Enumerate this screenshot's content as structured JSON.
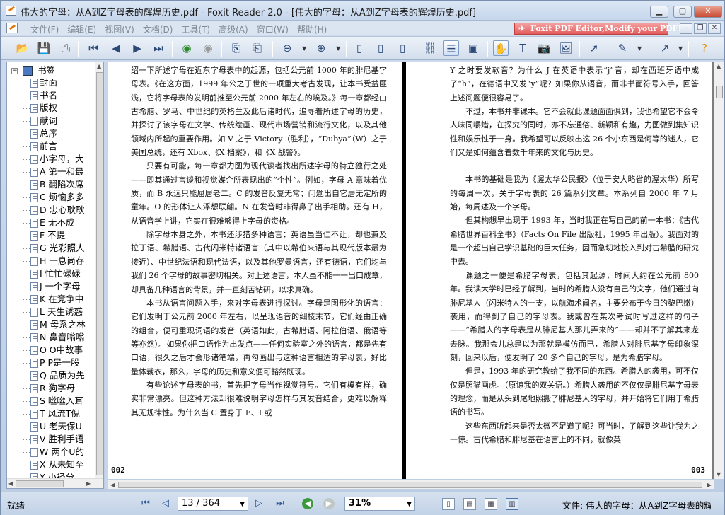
{
  "window": {
    "title": "伟大的字母：从A到Z字母表的辉煌历史.pdf - Foxit Reader 2.0 - [伟大的字母：从A到Z字母表的辉煌历史.pdf]",
    "min_label": "▁",
    "max_label": "▢",
    "close_label": "✕"
  },
  "menu": {
    "items": [
      "文件(F)",
      "编辑(E)",
      "视图(V)",
      "文档(D)",
      "工具(T)",
      "高级(A)",
      "窗口(W)",
      "帮助(H)"
    ],
    "ad_text": "Foxit PDF Editor,Modify your PDF!"
  },
  "toolbar": {
    "icons": [
      "open-icon",
      "save-icon",
      "print-icon",
      "first-page-icon",
      "prev-page-icon",
      "next-page-icon",
      "last-page-icon",
      "go-back-icon",
      "go-forward-icon",
      "rotate-left-icon",
      "rotate-right-icon",
      "zoom-out-icon",
      "zoom-in-icon",
      "single-page-icon",
      "continuous-icon",
      "facing-icon",
      "binoculars-icon",
      "bookmark-panel-icon",
      "thumbnail-icon",
      "hand-tool-icon",
      "text-select-icon",
      "snapshot-icon",
      "image-tool-icon",
      "select-arrow-icon",
      "annotation-icon",
      "pen-tool-icon",
      "help-icon"
    ]
  },
  "sidebar": {
    "root_label": "书签",
    "items": [
      {
        "label": "封面"
      },
      {
        "label": "书名"
      },
      {
        "label": "版权"
      },
      {
        "label": "献词"
      },
      {
        "label": "总序"
      },
      {
        "label": "前言"
      },
      {
        "label": "小字母，大"
      },
      {
        "label": "A 第一和最"
      },
      {
        "label": "B 翻陷次席"
      },
      {
        "label": "C 烦恼多多"
      },
      {
        "label": "D 忠心耿耿"
      },
      {
        "label": "E 无不成"
      },
      {
        "label": "F 不提"
      },
      {
        "label": "G 光彩照人"
      },
      {
        "label": "H 一息尚存"
      },
      {
        "label": "I 忙忙碌碌"
      },
      {
        "label": "J 一个字母"
      },
      {
        "label": "K 在竞争中"
      },
      {
        "label": "L 天生诱惑"
      },
      {
        "label": "M 母系之林"
      },
      {
        "label": "N 鼻音嗡嗡"
      },
      {
        "label": "O O中故事"
      },
      {
        "label": "P P是一股"
      },
      {
        "label": "Q 品质为先"
      },
      {
        "label": "R 狗字母"
      },
      {
        "label": "S 咝咝入耳"
      },
      {
        "label": "T 风流T倪"
      },
      {
        "label": "U 老天保U"
      },
      {
        "label": "V 胜利手语"
      },
      {
        "label": "W 两个U的"
      },
      {
        "label": "X 从未知至"
      },
      {
        "label": "Y 小径分"
      }
    ]
  },
  "document": {
    "left_page": {
      "number": "002",
      "paragraphs": [
        {
          "text": "绍一下所述字母在近东字母表中的起源，包括公元前 1000 年的腓尼基字母表。《在这方面，1999 年公之于世的一项重大考古发现，让本书受益匪浅，它将字母表的发明前推至公元前 2000 年左右的埃及。》每一章都经由古希腊、罗马、中世纪的英格兰及此后诸时代，追寻着所述字母的历史，并探讨了该字母在文学、传统绘画、现代市场营销和流行文化，以及其他领域内所起的重要作用。如 V 之于 Victory（胜利），“Dubya”（W）之于美国总统，还有 Xbox、《X 档案》，和《X 战警》。",
          "indent": false,
          "gap": false
        },
        {
          "text": "只要有可能，每一章都力图为现代读者找出所述字母的特立独行之处——即其通过言谈和视觉媒介所表现出的“个性”。例如，字母 A 意味着优质，而 B 永远只能屈居老二。C 的发音反复无常；问题出自它居无定所的童年。O 的形体让人浮想联翩。N 在发音时非得鼻子出手相助。还有 H，从语音学上讲，它实在很难够得上字母的资格。",
          "indent": true,
          "gap": false
        },
        {
          "text": "除字母本身之外，本书还涉猎多种语言：英语虽当仁不让，却也兼及拉丁语、希腊语、古代闪米特诸语言（其中以希伯来语与其现代版本最为接近）、中世纪法语和现代法语，以及其他罗曼语言，还有德语，它们均与我们 26 个字母的故事密切相关。对上述语言，本人虽不能一一出口成章，却具备几种语言的背景，并一直刻苦钻研，以求真确。",
          "indent": true,
          "gap": false
        },
        {
          "text": "本书从语言问题入手，来对字母表进行探讨。字母是图形化的语言：它们发明于公元前 2000 年左右，以呈现语音的细枝末节，它们经由正确的组合，便可重现词语的发音（英语如此，古希腊语、阿拉伯语、俄语等等亦然）。如果你把口语作为出发点——任何实验室之外的语言，都是先有口语，很久之后才会形诸笔端，再勾画出与这种语言相适的字母表，好比量体裁衣，那么，字母的历史和意义便可豁然既现。",
          "indent": true,
          "gap": false
        },
        {
          "text": "有些论述字母表的书，首先把字母当作视觉符号。它们有模有样，确实非常漂亮。但这种方法却很难说明字母怎样与其发音结合，更难以解释其无规律性。为什么当 C 置身于 E、I 或",
          "indent": true,
          "gap": false
        }
      ]
    },
    "right_page": {
      "number": "003",
      "paragraphs": [
        {
          "text": "Y 之时要发软音？为什么 J 在英语中表示“j”音，却在西班牙语中成了“h”，在德语中又发“y”呢？如果你从语音，而非书面符号入手，回答上述问题便很容易了。",
          "indent": false,
          "gap": false
        },
        {
          "text": "不过，本书并非课本。它不会就此课题面面俱到，我也希望它不会令人味同嚼蜡，在探究的同时，亦不忘通俗、新颖和有趣，力图做到集知识性和娱乐性于一身。我希望可以反映出这 26 个小东西是何等的迷人，它们又是如何蕴含着数千年来的文化与历史。",
          "indent": true,
          "gap": false
        },
        {
          "text": "本书的基础是我为《渥太华公民报》（位于安大略省的渥太华）所写的每周一次，关于字母表的 26 篇系列文章。本系列自 2000 年 7 月始，每周述及一个字母。",
          "indent": true,
          "gap": true
        },
        {
          "text": "但其构想早出现于 1993 年，当时我正在写自己的前一本书：《古代希腊世界百科全书》（Facts On File 出版社，1995 年出版）。我面对的是一个超出自己学识基础的巨大任务，因而急切地投入到对古希腊的研究中去。",
          "indent": true,
          "gap": false
        },
        {
          "text": "课题之一便是希腊字母表，包括其起源，时间大约在公元前 800 年。我读大学时已经了解到，当时的希腊人没有自己的文字，他们通过向腓尼基人（闪米特人的一支，以航海术闻名，主要分布于今日的黎巴嫩）袭用，而得到了自己的字母表。我或曾在某次考试时写过这样的句子——“希腊人的字母表是从腓尼基人那儿弄来的”——却并不了解其来龙去脉。我那会儿总是以为那就是模仿而已，希腊人对腓尼基字母印象深刻，回来以后，便发明了 20 多个自己的字母，是为希腊字母。",
          "indent": true,
          "gap": false
        },
        {
          "text": "但是，1993 年的研究教给了我不同的东西。希腊人的袭用，可不仅仅是照猫画虎。（原谅我的双关语。）希腊人袭用的不仅仅是腓尼基字母表的理念，而是从头到尾地照搬了腓尼基人的字母，并开始将它们用于希腊语的书写。",
          "indent": true,
          "gap": false
        },
        {
          "text": "这些东西听起来是否太微不足道了呢？可当时，了解到这些让我为之一惊。古代希腊和腓尼基在语言上的不同，就像英",
          "indent": true,
          "gap": false
        }
      ]
    }
  },
  "statusbar": {
    "ready": "就绪",
    "page_field": "13 / 364",
    "zoom_field": "31%",
    "file_label": "文件: 伟大的字母：从A到Z字母表的辉煌历史"
  }
}
